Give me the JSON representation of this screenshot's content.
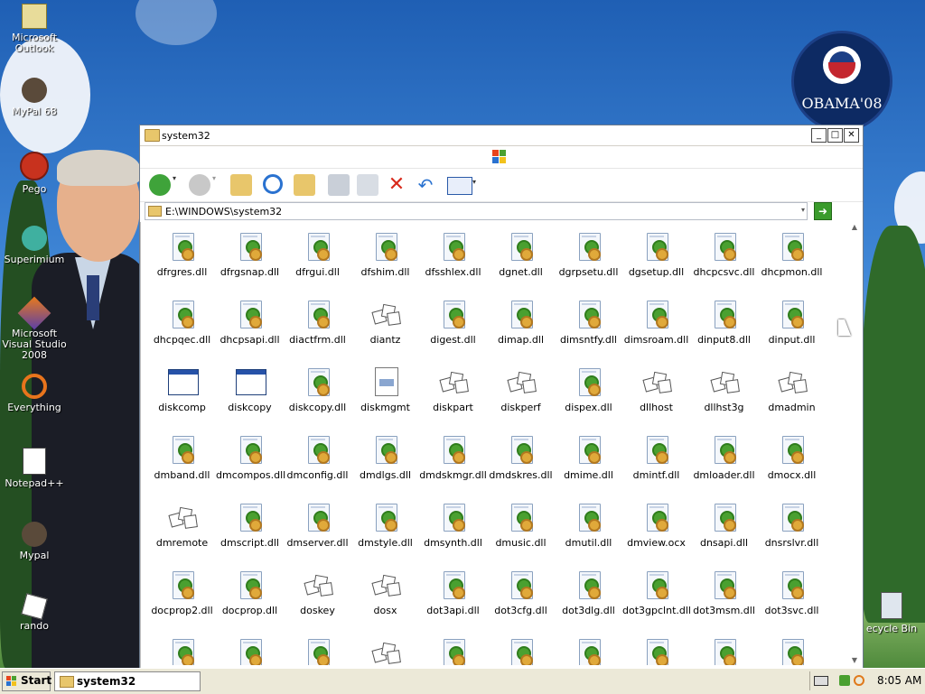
{
  "desktop": {
    "icons": [
      {
        "label": "Microsoft Outlook",
        "icon": "outlook-icon"
      },
      {
        "label": "MyPal 68",
        "icon": "mypal-icon"
      },
      {
        "label": "Pego",
        "icon": "pego-icon"
      },
      {
        "label": "Superimium",
        "icon": "superimium-icon"
      },
      {
        "label": "Microsoft Visual Studio 2008",
        "icon": "visual-studio-icon"
      },
      {
        "label": "Everything",
        "icon": "everything-icon"
      },
      {
        "label": "Notepad++",
        "icon": "notepadpp-icon"
      },
      {
        "label": "Mypal",
        "icon": "mypal-icon"
      },
      {
        "label": "rando",
        "icon": "dice-icon"
      }
    ],
    "badge_text": "OBAMA'08",
    "recycle_label": "ecycle Bin"
  },
  "window": {
    "title": "system32",
    "address": "E:\\WINDOWS\\system32",
    "files": [
      {
        "name": "dfrgres.dll",
        "type": "dll"
      },
      {
        "name": "dfrgsnap.dll",
        "type": "dll"
      },
      {
        "name": "dfrgui.dll",
        "type": "dll"
      },
      {
        "name": "dfshim.dll",
        "type": "dll"
      },
      {
        "name": "dfsshlex.dll",
        "type": "dll"
      },
      {
        "name": "dgnet.dll",
        "type": "dll"
      },
      {
        "name": "dgrpsetu.dll",
        "type": "dll"
      },
      {
        "name": "dgsetup.dll",
        "type": "dll"
      },
      {
        "name": "dhcpcsvc.dll",
        "type": "dll"
      },
      {
        "name": "dhcpmon.dll",
        "type": "dll"
      },
      {
        "name": "dhcpqec.dll",
        "type": "dll"
      },
      {
        "name": "dhcpsapi.dll",
        "type": "dll"
      },
      {
        "name": "diactfrm.dll",
        "type": "dll"
      },
      {
        "name": "diantz",
        "type": "dice"
      },
      {
        "name": "digest.dll",
        "type": "dll"
      },
      {
        "name": "dimap.dll",
        "type": "dll"
      },
      {
        "name": "dimsntfy.dll",
        "type": "dll"
      },
      {
        "name": "dimsroam.dll",
        "type": "dll"
      },
      {
        "name": "dinput8.dll",
        "type": "dll"
      },
      {
        "name": "dinput.dll",
        "type": "dll"
      },
      {
        "name": "diskcomp",
        "type": "exe"
      },
      {
        "name": "diskcopy",
        "type": "exe"
      },
      {
        "name": "diskcopy.dll",
        "type": "dll"
      },
      {
        "name": "diskmgmt",
        "type": "msc"
      },
      {
        "name": "diskpart",
        "type": "dice"
      },
      {
        "name": "diskperf",
        "type": "dice"
      },
      {
        "name": "dispex.dll",
        "type": "dll"
      },
      {
        "name": "dllhost",
        "type": "dice"
      },
      {
        "name": "dllhst3g",
        "type": "dice"
      },
      {
        "name": "dmadmin",
        "type": "dice"
      },
      {
        "name": "dmband.dll",
        "type": "dll"
      },
      {
        "name": "dmcompos.dll",
        "type": "dll"
      },
      {
        "name": "dmconfig.dll",
        "type": "dll"
      },
      {
        "name": "dmdlgs.dll",
        "type": "dll"
      },
      {
        "name": "dmdskmgr.dll",
        "type": "dll"
      },
      {
        "name": "dmdskres.dll",
        "type": "dll"
      },
      {
        "name": "dmime.dll",
        "type": "dll"
      },
      {
        "name": "dmintf.dll",
        "type": "dll"
      },
      {
        "name": "dmloader.dll",
        "type": "dll"
      },
      {
        "name": "dmocx.dll",
        "type": "dll"
      },
      {
        "name": "dmremote",
        "type": "dice"
      },
      {
        "name": "dmscript.dll",
        "type": "dll"
      },
      {
        "name": "dmserver.dll",
        "type": "dll"
      },
      {
        "name": "dmstyle.dll",
        "type": "dll"
      },
      {
        "name": "dmsynth.dll",
        "type": "dll"
      },
      {
        "name": "dmusic.dll",
        "type": "dll"
      },
      {
        "name": "dmutil.dll",
        "type": "dll"
      },
      {
        "name": "dmview.ocx",
        "type": "dll"
      },
      {
        "name": "dnsapi.dll",
        "type": "dll"
      },
      {
        "name": "dnsrslvr.dll",
        "type": "dll"
      },
      {
        "name": "docprop2.dll",
        "type": "dll"
      },
      {
        "name": "docprop.dll",
        "type": "dll"
      },
      {
        "name": "doskey",
        "type": "dice"
      },
      {
        "name": "dosx",
        "type": "dice"
      },
      {
        "name": "dot3api.dll",
        "type": "dll"
      },
      {
        "name": "dot3cfg.dll",
        "type": "dll"
      },
      {
        "name": "dot3dlg.dll",
        "type": "dll"
      },
      {
        "name": "dot3gpclnt.dll",
        "type": "dll"
      },
      {
        "name": "dot3msm.dll",
        "type": "dll"
      },
      {
        "name": "dot3svc.dll",
        "type": "dll"
      },
      {
        "name": "",
        "type": "dll"
      },
      {
        "name": "",
        "type": "dll"
      },
      {
        "name": "",
        "type": "dll"
      },
      {
        "name": "",
        "type": "dice"
      },
      {
        "name": "",
        "type": "dll"
      },
      {
        "name": "",
        "type": "dll"
      },
      {
        "name": "",
        "type": "dll"
      },
      {
        "name": "",
        "type": "dll"
      },
      {
        "name": "",
        "type": "dll"
      },
      {
        "name": "",
        "type": "dll"
      }
    ]
  },
  "taskbar": {
    "start_label": "Start",
    "task_label": "system32",
    "clock": "8:05 AM"
  }
}
